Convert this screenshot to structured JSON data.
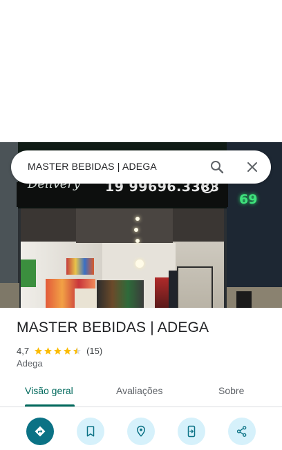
{
  "search": {
    "query": "MASTER BEBIDAS | ADEGA"
  },
  "photo": {
    "sign_script": "Delivery",
    "sign_phone": "19 99696.3383",
    "neon_number": "69"
  },
  "place": {
    "title": "MASTER BEBIDAS | ADEGA",
    "rating": "4,7",
    "stars_fraction": 0.94,
    "review_count": "(15)",
    "category": "Adega"
  },
  "tabs": [
    {
      "label": "Visão geral",
      "active": true
    },
    {
      "label": "Avaliações",
      "active": false
    },
    {
      "label": "Sobre",
      "active": false
    }
  ],
  "actions": [
    {
      "icon": "directions-icon"
    },
    {
      "icon": "bookmark-icon"
    },
    {
      "icon": "nearby-icon"
    },
    {
      "icon": "send-to-phone-icon"
    },
    {
      "icon": "share-icon"
    }
  ],
  "colors": {
    "accent": "#00695c",
    "star": "#fbbc04",
    "action_bg": "#d6f1fb",
    "primary_action": "#0b7285"
  }
}
